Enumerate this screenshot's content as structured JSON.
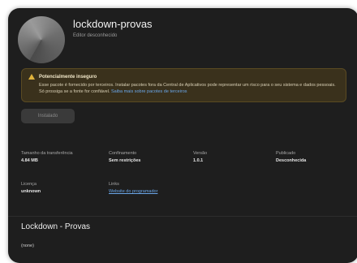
{
  "app": {
    "title": "lockdown-provas",
    "publisher": "Editor desconhecido"
  },
  "warning": {
    "icon": "warning-icon",
    "title": "Potencialmente inseguro",
    "text": "Esse pacote é fornecido por terceiros. Instalar pacotes fora da Central de Aplicativos pode representar um risco para o seu sistema e dados pessoais. Só prossiga se a fonte for confiável.",
    "link": "Saiba mais sobre pacotes de terceiros",
    "color": "#e0b33c"
  },
  "install": {
    "label": "Instalado"
  },
  "info": {
    "download_size": {
      "label": "Tamanho da transferência",
      "value": "4.84 MB"
    },
    "confinement": {
      "label": "Confinamento",
      "value": "Sem restrições"
    },
    "version": {
      "label": "Versão",
      "value": "1.0.1"
    },
    "published": {
      "label": "Publicado",
      "value": "Desconhecida"
    },
    "license": {
      "label": "Licença",
      "value": "unknown"
    },
    "links": {
      "label": "Links",
      "value": "Website do programador"
    }
  },
  "details": {
    "title": "Lockdown - Provas",
    "description": "(none)"
  }
}
